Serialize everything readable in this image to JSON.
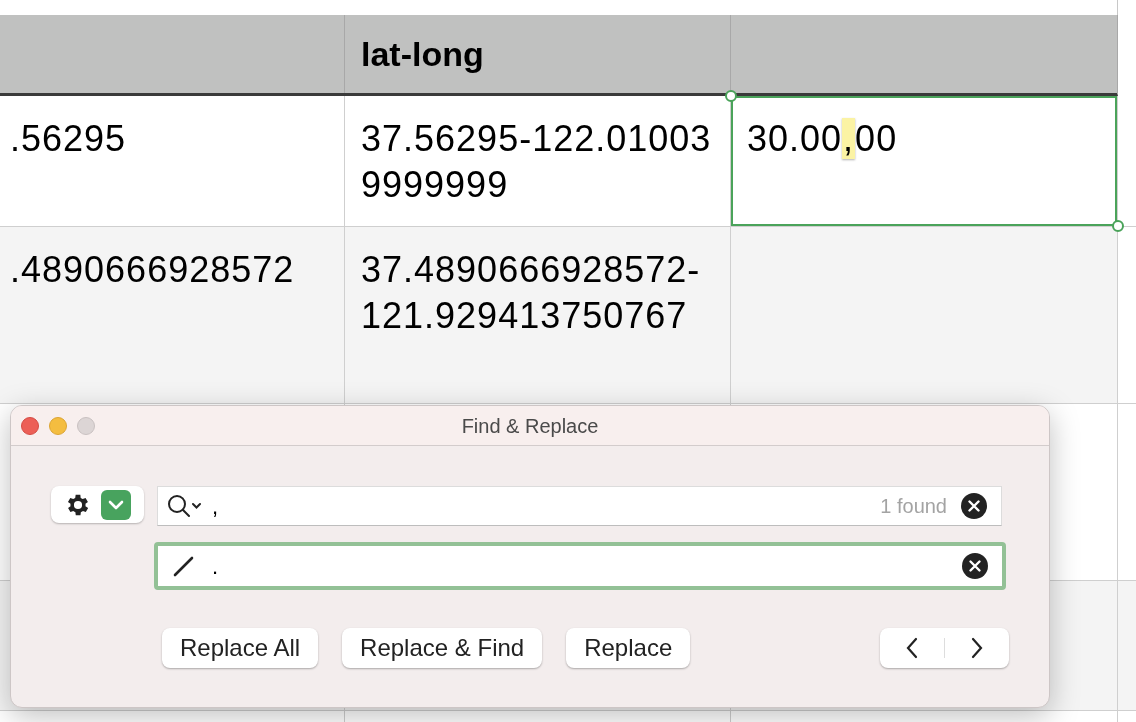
{
  "table": {
    "columns": [
      {},
      {
        "label": "lat-long"
      },
      {}
    ],
    "rows": [
      {
        "cells": [
          {
            "text": ".56295",
            "selected": false
          },
          {
            "text": "37.56295-122.010039999999",
            "selected": false
          },
          {
            "selected": true,
            "segments": [
              {
                "text": "30.00",
                "highlighted": false
              },
              {
                "text": ",",
                "highlighted": true
              },
              {
                "text": "00",
                "highlighted": false
              }
            ]
          }
        ]
      },
      {
        "cells": [
          {
            "text": ".4890666928572",
            "selected": false
          },
          {
            "text": "37.4890666928572-121.929413750767",
            "selected": false
          },
          {
            "selected": false
          }
        ]
      }
    ]
  },
  "dialog": {
    "title": "Find & Replace",
    "zoom_enabled": false,
    "find": {
      "value": ",",
      "count": "1 found",
      "focused": false
    },
    "replace": {
      "value": ".",
      "focused": true
    },
    "buttons": [
      "Replace All",
      "Replace & Find",
      "Replace"
    ]
  }
}
